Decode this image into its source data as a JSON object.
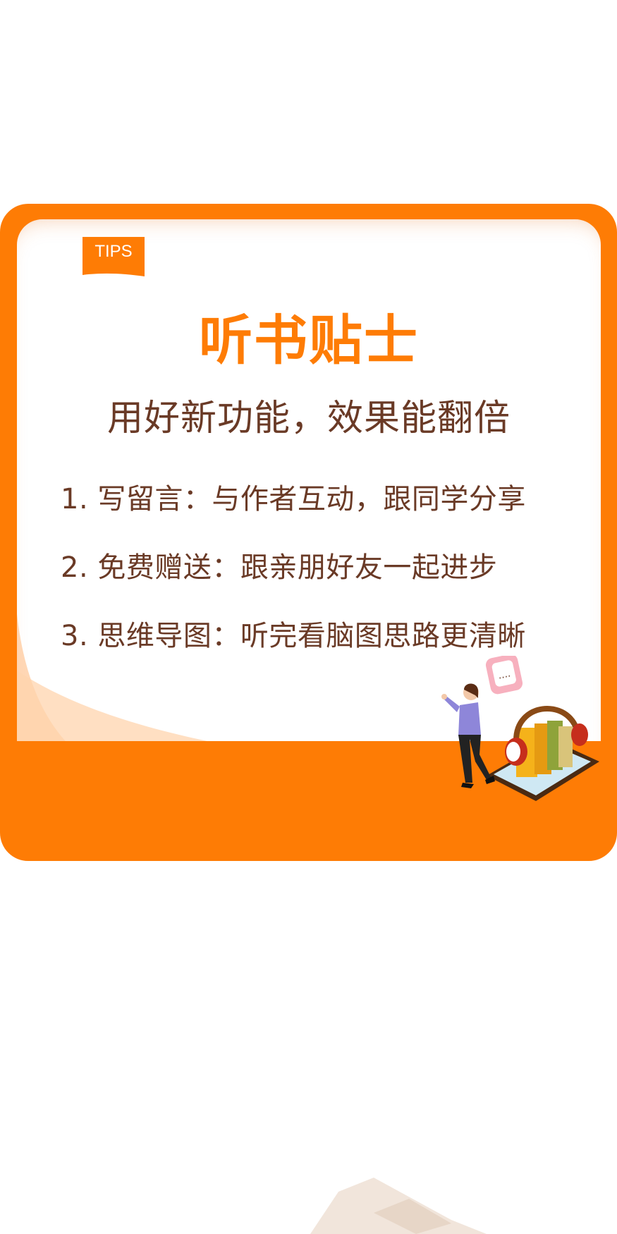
{
  "card": {
    "tag": "TIPS",
    "title": "听书贴士",
    "subtitle": "用好新功能，效果能翻倍",
    "tips": [
      "1. 写留言：与作者互动，跟同学分享",
      "2. 免费赠送：跟亲朋好友一起进步",
      "3. 思维导图：听完看脑图思路更清晰"
    ]
  },
  "illustration": {
    "chat_bubble_text": "...."
  },
  "colors": {
    "accent": "#fe7c05",
    "text": "#6a3a26",
    "background": "#ffffff"
  },
  "icons": [
    "tips-tag-icon",
    "person-illustration",
    "book-stack-icon",
    "headphones-icon",
    "tablet-icon",
    "chat-bubble-icon"
  ]
}
